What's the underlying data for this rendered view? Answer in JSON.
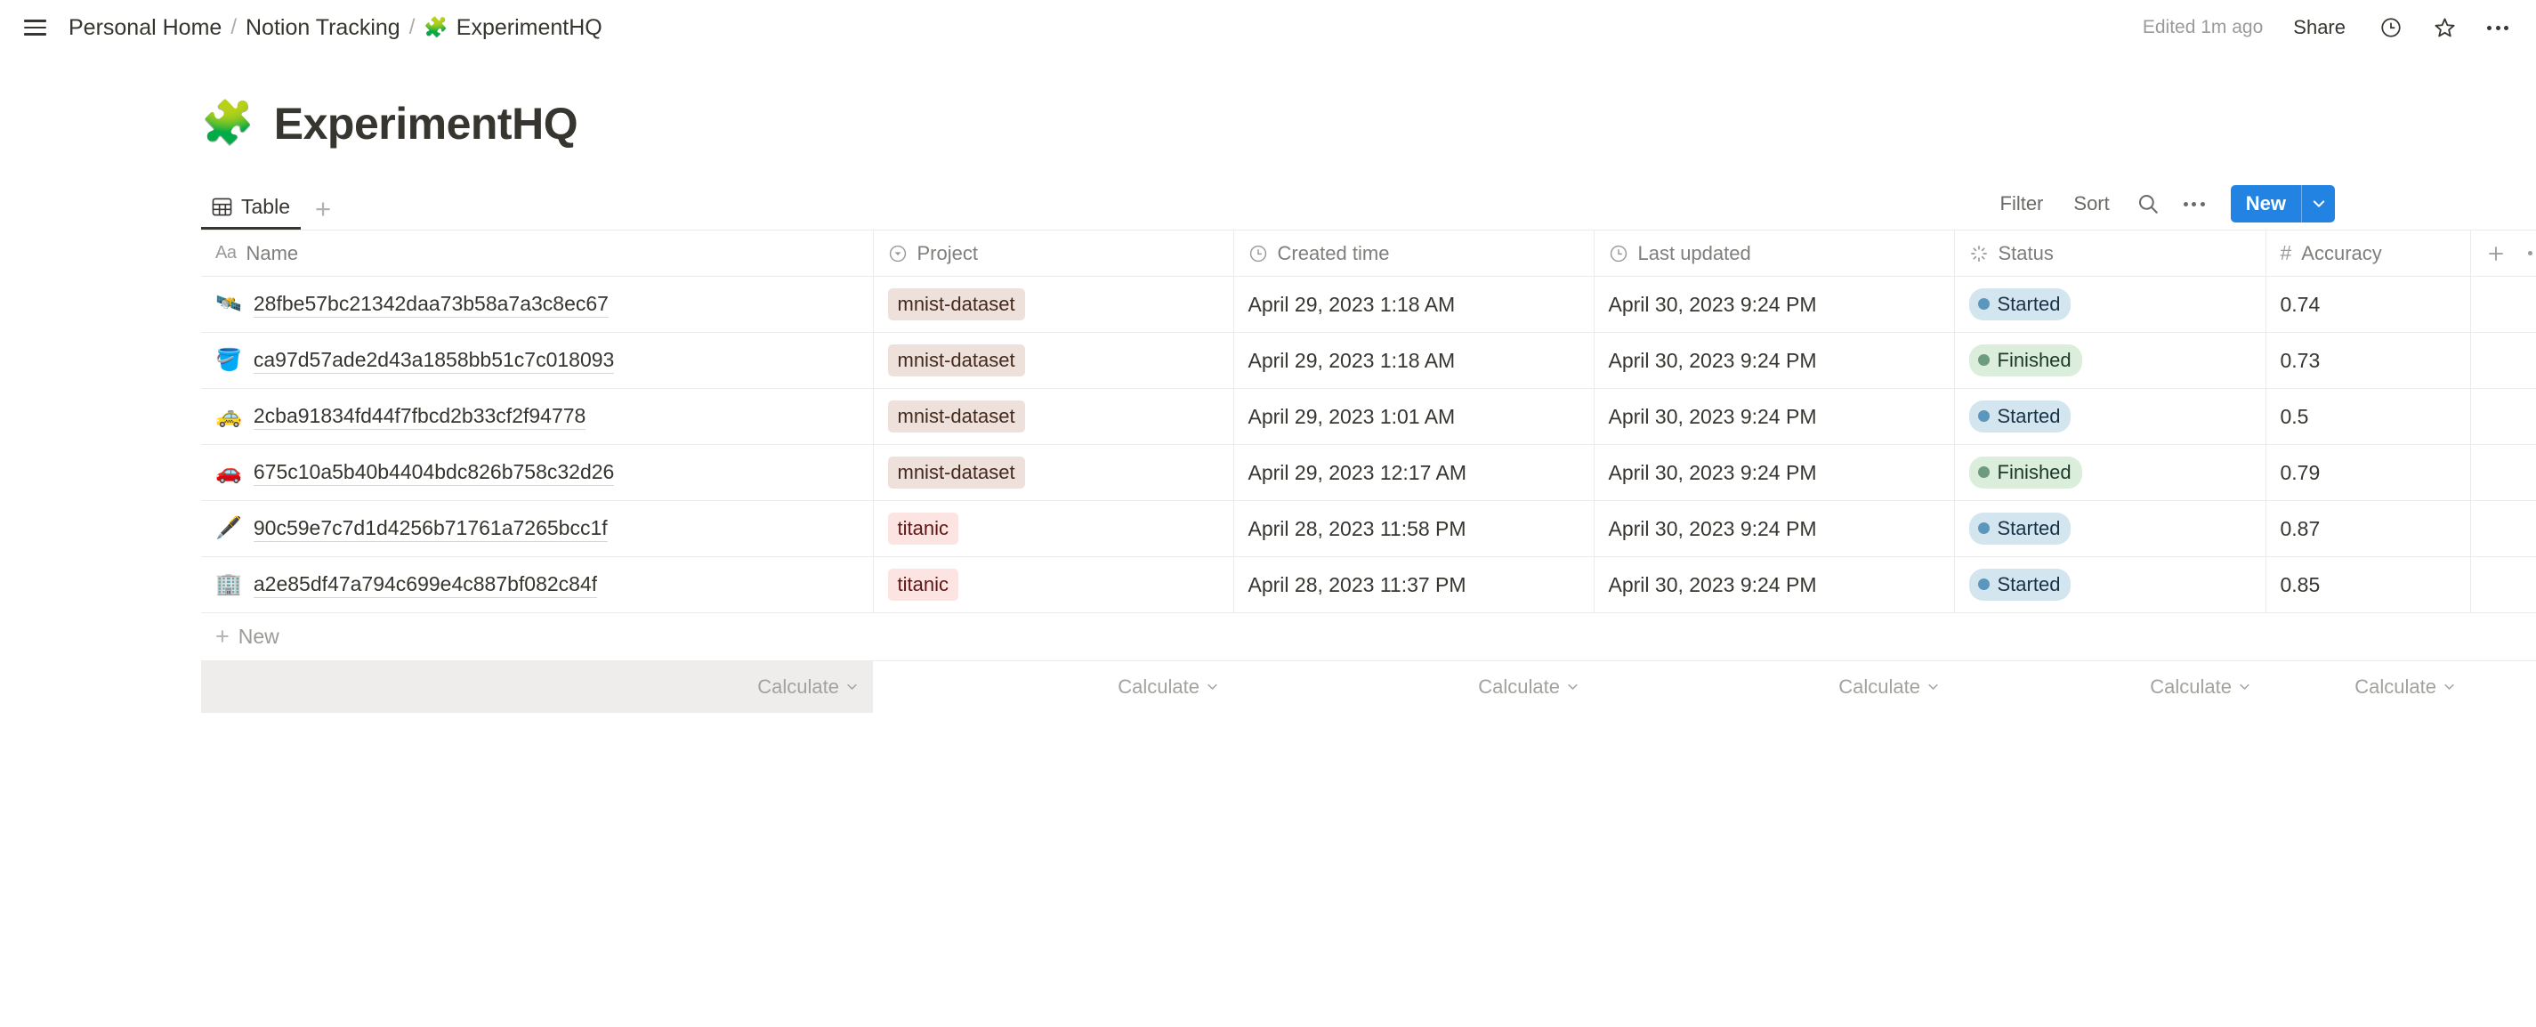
{
  "topbar": {
    "menu_icon": "hamburger-icon",
    "breadcrumb": {
      "items": [
        {
          "label": "Personal Home"
        },
        {
          "label": "Notion Tracking"
        },
        {
          "label": "ExperimentHQ",
          "emoji": "🧩"
        }
      ],
      "separator": "/"
    },
    "edited_label": "Edited 1m ago",
    "share_label": "Share",
    "history_icon": "clock-icon",
    "favorite_icon": "star-icon",
    "more_icon": "more-options-icon"
  },
  "page": {
    "emoji": "🧩",
    "title": "ExperimentHQ"
  },
  "toolbar": {
    "tabs": [
      {
        "label": "Table",
        "icon": "table-icon",
        "active": true
      }
    ],
    "add_view_label": "+",
    "filter_label": "Filter",
    "sort_label": "Sort",
    "search_icon": "search-icon",
    "more_icon": "more-options-icon",
    "new_label": "New",
    "new_caret_icon": "chevron-down-icon",
    "accent_color": "#2383e2"
  },
  "table": {
    "columns": [
      {
        "label": "Name",
        "icon": "text-type-icon",
        "type": "title"
      },
      {
        "label": "Project",
        "icon": "select-type-icon",
        "type": "select"
      },
      {
        "label": "Created time",
        "icon": "clock-icon",
        "type": "date"
      },
      {
        "label": "Last updated",
        "icon": "clock-icon",
        "type": "date"
      },
      {
        "label": "Status",
        "icon": "status-icon",
        "type": "status"
      },
      {
        "label": "Accuracy",
        "icon": "number-type-icon",
        "type": "number"
      }
    ],
    "add_column_icon": "plus-icon",
    "column_options_icon": "more-options-icon",
    "rows": [
      {
        "emoji": "🛰️",
        "name": "28fbe57bc21342daa73b58a7a3c8ec67",
        "project": "mnist-dataset",
        "project_color": "brown",
        "created": "April 29, 2023 1:18 AM",
        "updated": "April 30, 2023 9:24 PM",
        "status": "Started",
        "status_color": "blue",
        "accuracy": "0.74"
      },
      {
        "emoji": "🪣",
        "name": "ca97d57ade2d43a1858bb51c7c018093",
        "project": "mnist-dataset",
        "project_color": "brown",
        "created": "April 29, 2023 1:18 AM",
        "updated": "April 30, 2023 9:24 PM",
        "status": "Finished",
        "status_color": "green",
        "accuracy": "0.73"
      },
      {
        "emoji": "🚕",
        "name": "2cba91834fd44f7fbcd2b33cf2f94778",
        "project": "mnist-dataset",
        "project_color": "brown",
        "created": "April 29, 2023 1:01 AM",
        "updated": "April 30, 2023 9:24 PM",
        "status": "Started",
        "status_color": "blue",
        "accuracy": "0.5"
      },
      {
        "emoji": "🚗",
        "name": "675c10a5b40b4404bdc826b758c32d26",
        "project": "mnist-dataset",
        "project_color": "brown",
        "created": "April 29, 2023 12:17 AM",
        "updated": "April 30, 2023 9:24 PM",
        "status": "Finished",
        "status_color": "green",
        "accuracy": "0.79"
      },
      {
        "emoji": "🖋️",
        "name": "90c59e7c7d1d4256b71761a7265bcc1f",
        "project": "titanic",
        "project_color": "pink",
        "created": "April 28, 2023 11:58 PM",
        "updated": "April 30, 2023 9:24 PM",
        "status": "Started",
        "status_color": "blue",
        "accuracy": "0.87"
      },
      {
        "emoji": "🏢",
        "name": "a2e85df47a794c699e4c887bf082c84f",
        "project": "titanic",
        "project_color": "pink",
        "created": "April 28, 2023 11:37 PM",
        "updated": "April 30, 2023 9:24 PM",
        "status": "Started",
        "status_color": "blue",
        "accuracy": "0.85"
      }
    ],
    "new_row_label": "New",
    "footer": {
      "calculate_label": "Calculate",
      "count": 6
    }
  },
  "colors": {
    "accent_blue": "#2383e2",
    "pill_brown_bg": "#eee0da",
    "pill_pink_bg": "#fbe4e1",
    "status_started_bg": "#d3e5ef",
    "status_finished_bg": "#dbeddb",
    "border": "#ecebea"
  }
}
